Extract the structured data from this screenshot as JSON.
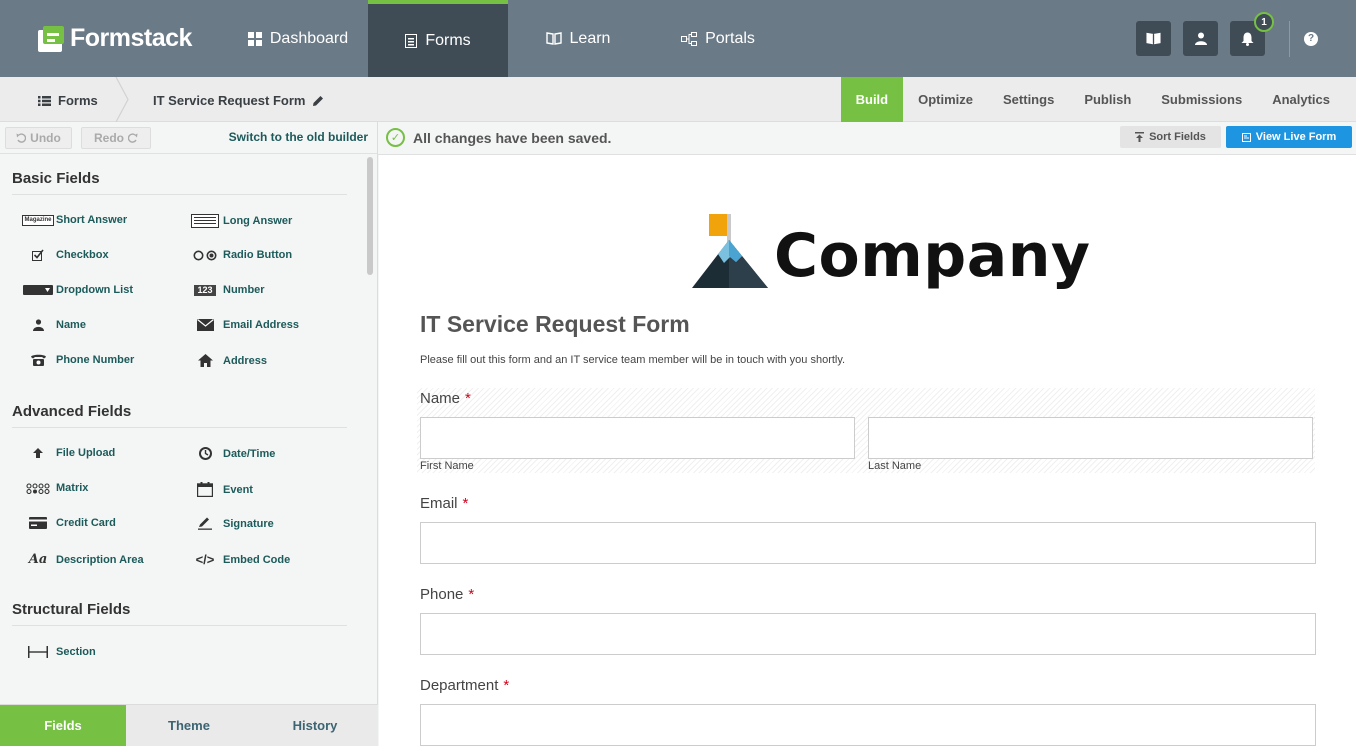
{
  "app": {
    "logo_text": "Formstack",
    "nav": [
      {
        "label": "Dashboard",
        "icon": "dashboard-icon"
      },
      {
        "label": "Forms",
        "icon": "forms-icon"
      },
      {
        "label": "Learn",
        "icon": "book-icon"
      },
      {
        "label": "Portals",
        "icon": "portals-icon"
      }
    ],
    "notification_count": "1",
    "help_glyph": "?"
  },
  "subnav": {
    "crumb_forms": "Forms",
    "crumb_form_name": "IT Service Request Form",
    "tabs": [
      "Build",
      "Optimize",
      "Settings",
      "Publish",
      "Submissions",
      "Analytics"
    ],
    "active_tab": "Build"
  },
  "toolbar": {
    "undo": "Undo",
    "redo": "Redo",
    "old_builder": "Switch to the old builder",
    "saved": "All changes have been saved.",
    "sort_fields": "Sort Fields",
    "view_live": "View Live Form"
  },
  "fields_panel": {
    "basic_title": "Basic Fields",
    "basic": [
      "Short Answer",
      "Long Answer",
      "Checkbox",
      "Radio Button",
      "Dropdown List",
      "Number",
      "Name",
      "Email Address",
      "Phone Number",
      "Address"
    ],
    "advanced_title": "Advanced Fields",
    "advanced": [
      "File Upload",
      "Date/Time",
      "Matrix",
      "Event",
      "Credit Card",
      "Signature",
      "Description Area",
      "Embed Code"
    ],
    "structural_title": "Structural Fields",
    "structural": [
      "Section"
    ],
    "icon_text": {
      "magazine": "Magazine",
      "number": "123",
      "desc": "Aa",
      "embed": "</>"
    }
  },
  "bottom_tabs": [
    "Fields",
    "Theme",
    "History"
  ],
  "form": {
    "company": "Company",
    "title": "IT Service Request Form",
    "description": "Please fill out this form and an IT service team member will be in touch with you shortly.",
    "required_mark": "*",
    "name_label": "Name",
    "first_name": "First Name",
    "last_name": "Last Name",
    "email_label": "Email",
    "phone_label": "Phone",
    "department_label": "Department"
  },
  "colors": {
    "accent_green": "#76c043",
    "nav_bg": "#6a7a86",
    "nav_active": "#3f4c56",
    "primary_blue": "#1e95e0",
    "required_red": "#d0021b"
  }
}
